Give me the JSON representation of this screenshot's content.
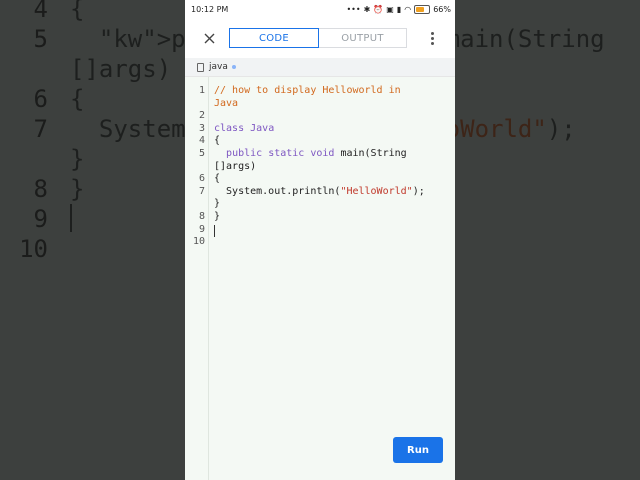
{
  "background": {
    "lines": [
      {
        "num": "4",
        "code": "{"
      },
      {
        "num": "5",
        "code": "  public static void main(String"
      },
      {
        "num": "",
        "code": "[]args)"
      },
      {
        "num": "6",
        "code": "{"
      },
      {
        "num": "7",
        "code": "  System.out.println(\"HelloWorld\");"
      },
      {
        "num": "",
        "code": "}"
      },
      {
        "num": "8",
        "code": "}"
      },
      {
        "num": "9",
        "code": ""
      },
      {
        "num": "10",
        "code": ""
      }
    ]
  },
  "status_bar": {
    "time": "10:12 PM",
    "battery": "66%",
    "battery_level": 0.66
  },
  "toolbar": {
    "tabs": [
      {
        "label": "CODE",
        "active": true
      },
      {
        "label": "OUTPUT",
        "active": false
      }
    ]
  },
  "file": {
    "name": "java"
  },
  "editor": {
    "lines": [
      {
        "num": "1",
        "text": "// how to display Helloworld in",
        "style": "comment"
      },
      {
        "num": "",
        "text": "Java",
        "style": "comment"
      },
      {
        "num": "2",
        "text": "",
        "style": "plain"
      },
      {
        "num": "3",
        "text": "class Java",
        "style": "class"
      },
      {
        "num": "4",
        "text": "{",
        "style": "plain"
      },
      {
        "num": "5",
        "text": "  public static void main(String",
        "style": "method"
      },
      {
        "num": "",
        "text": "[]args)",
        "style": "plain"
      },
      {
        "num": "6",
        "text": "{",
        "style": "plain"
      },
      {
        "num": "7",
        "text": "  System.out.println(\"HelloWorld\");",
        "style": "print"
      },
      {
        "num": "",
        "text": "}",
        "style": "plain"
      },
      {
        "num": "8",
        "text": "}",
        "style": "plain"
      },
      {
        "num": "9",
        "text": "",
        "style": "plain"
      },
      {
        "num": "10",
        "text": "",
        "style": "plain"
      }
    ]
  },
  "run_button": {
    "label": "Run"
  },
  "colors": {
    "accent": "#1a73e8",
    "comment": "#d2691e",
    "keyword": "#7e57c2",
    "string": "#c0392b"
  }
}
